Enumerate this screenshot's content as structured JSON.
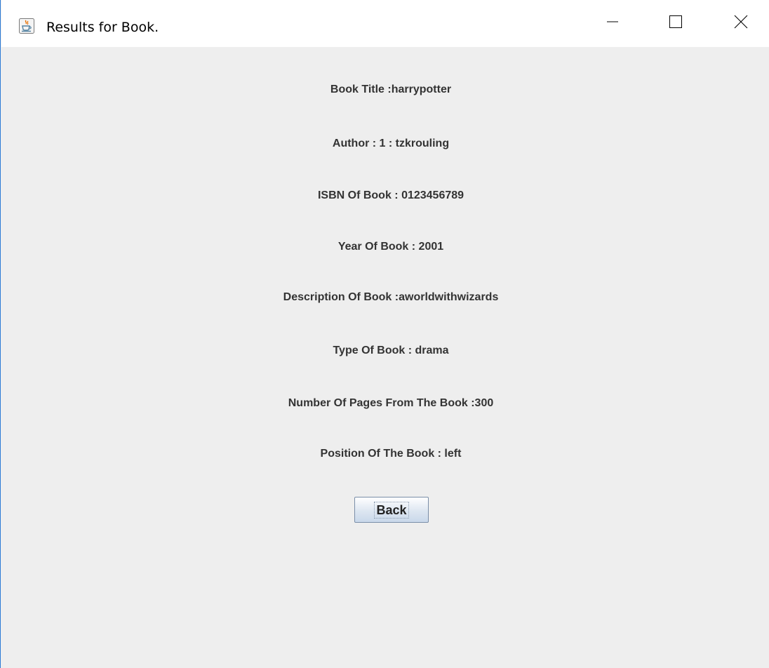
{
  "window": {
    "title": "Results for Book.",
    "icon": "java-cup-icon",
    "controls": [
      "minimize-icon",
      "maximize-icon",
      "close-icon"
    ]
  },
  "book": {
    "title_line": "Book Title :harrypotter",
    "author_line": "Author : 1 : tzkrouling",
    "isbn_line": "ISBN Of Book : 0123456789",
    "year_line": "Year Of Book : 2001",
    "description_line": "Description Of Book :aworldwithwizards",
    "type_line": "Type Of Book : drama",
    "pages_line": "Number Of Pages From The Book :300",
    "position_line": "Position Of The Book : left"
  },
  "actions": {
    "back_label": "Back"
  },
  "colors": {
    "window_border": "#2b7bd6",
    "content_bg": "#eeeeee",
    "text": "#333333"
  }
}
